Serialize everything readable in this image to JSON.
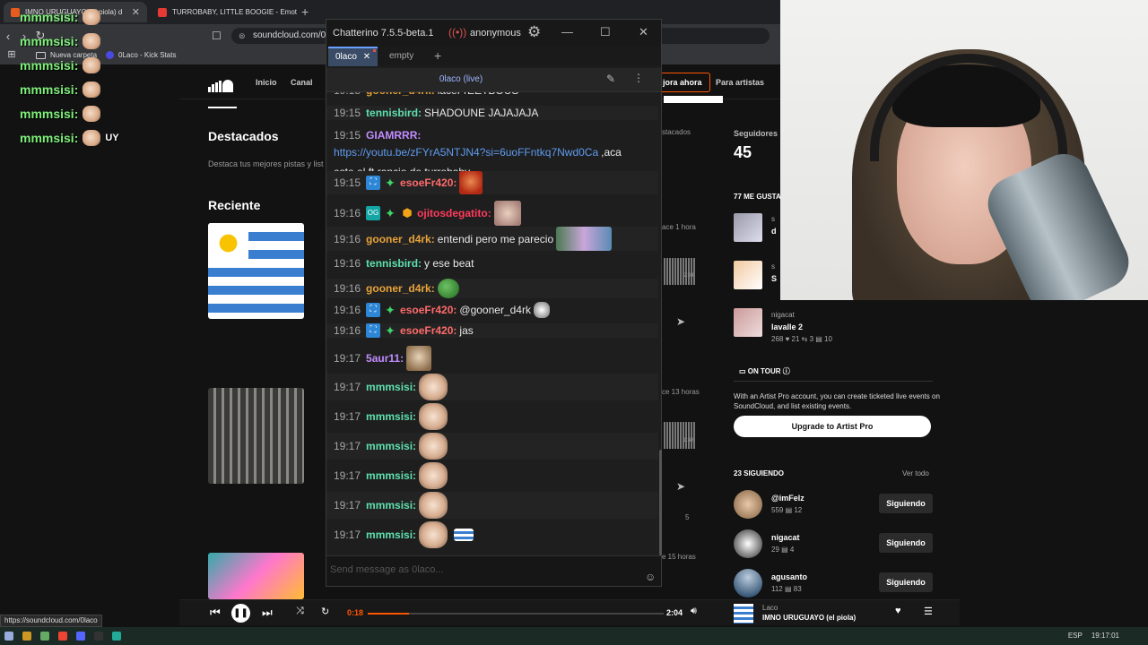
{
  "browser": {
    "tabs": [
      {
        "label": "IMNO URUGUAYO (el piola) d"
      },
      {
        "label": "TURROBABY, LITTLE BOOGIE - Emot"
      }
    ],
    "url": "soundcloud.com/0la",
    "bookmarks": [
      {
        "label": "Nueva carpeta"
      },
      {
        "label": "0Laco - Kick Stats"
      }
    ],
    "status_url": "https://soundcloud.com/0laco"
  },
  "overlay_chat": [
    {
      "user": "mmmsisi:",
      "text": ""
    },
    {
      "user": "mmmsisi:",
      "text": ""
    },
    {
      "user": "mmmsisi:",
      "text": ""
    },
    {
      "user": "mmmsisi:",
      "text": ""
    },
    {
      "user": "mmmsisi:",
      "text": ""
    },
    {
      "user": "mmmsisi:",
      "text": "UY"
    }
  ],
  "soundcloud": {
    "nav": {
      "home": "Inicio",
      "feed": "Canal",
      "premium": "jora ahora",
      "artists": "Para artistas"
    },
    "featured_title": "Destacados",
    "featured_sub": "Destaca tus mejores pistas y list",
    "recent_title": "Recient",
    "recent_title_full": "Reciente",
    "meta": {
      "tab_featured": "stacados",
      "ago1": "ace 1 hora",
      "time1": "2:04",
      "ago2": "ce 13 horas",
      "time2": "1:48",
      "plays": "5",
      "ago3": "e 15 horas"
    },
    "followers_label": "Seguidores",
    "followers_value": "45",
    "likes_label": "77 ME GUSTA",
    "liked_items": [
      {
        "name": "s",
        "title": "d"
      },
      {
        "name": "s",
        "title": "S"
      },
      {
        "name": "nigacat",
        "title": "lavalle 2",
        "stats": "268  ♥ 21  ⇆ 3  ▤ 10"
      }
    ],
    "tour_label": "ON TOUR",
    "tour_text": "With an Artist Pro account, you can create ticketed live events on SoundCloud, and list existing events.",
    "upgrade_label": "Upgrade to Artist Pro",
    "following_label": "23 SIGUIENDO",
    "view_all": "Ver todo",
    "following": [
      {
        "name": "@imFelz",
        "stats": "559  ▤ 12",
        "button": "Siguiendo"
      },
      {
        "name": "nigacat",
        "stats": "29  ▤ 4",
        "button": "Siguiendo"
      },
      {
        "name": "agusanto",
        "stats": "112  ▤ 83",
        "button": "Siguiendo"
      }
    ]
  },
  "player": {
    "elapsed": "0:18",
    "duration": "2:04",
    "progress": 0.14,
    "artist": "Laco",
    "title": "IMNO URUGUAYO (el piola)"
  },
  "taskbar": {
    "lang": "ESP",
    "time": "19:17:01"
  },
  "chatterino": {
    "title": "Chatterino 7.5.5-beta.1",
    "user": "anonymous",
    "tabs": [
      {
        "label": "0laco"
      },
      {
        "label": "empty"
      }
    ],
    "split_channel": "0laco (live)",
    "input_placeholder": "Send message as 0laco...",
    "messages": [
      {
        "time": "19:15",
        "user": "gooner_d4rk:",
        "color": "#e8a33a",
        "text": "laceFrEETBOUS",
        "badges": []
      },
      {
        "time": "19:15",
        "user": "tennisbird:",
        "color": "#5ee0b0",
        "text": "SHADOUNE JAJAJAJA",
        "badges": []
      },
      {
        "time": "19:15",
        "user": "GIAMRRR:",
        "color": "#c28cff",
        "link": "https://youtu.be/zFYrA5NTJN4?si=6uoFFntkq7Nwd0Ca",
        "text": " ,aca",
        "text2": "este el ft rancio de turrobaby",
        "badges": []
      },
      {
        "time": "19:15",
        "user": "esoeFr420:",
        "color": "#ff6b6b",
        "text": "",
        "emote": "face",
        "badges": [
          "sub",
          "star"
        ]
      },
      {
        "time": "19:16",
        "user": "ojitosdegatito:",
        "color": "#ff3b5c",
        "text": "",
        "emote": "cat",
        "badges": [
          "og",
          "star",
          "gift"
        ]
      },
      {
        "time": "19:16",
        "user": "gooner_d4rk:",
        "color": "#e8a33a",
        "text": "entendi pero me parecio",
        "emote": "wide",
        "badges": []
      },
      {
        "time": "19:16",
        "user": "tennisbird:",
        "color": "#5ee0b0",
        "text": "y ese beat",
        "badges": []
      },
      {
        "time": "19:16",
        "user": "gooner_d4rk:",
        "color": "#e8a33a",
        "text": "",
        "emote": "frog",
        "badges": []
      },
      {
        "time": "19:16",
        "user": "esoeFr420:",
        "color": "#ff6b6b",
        "text": "@gooner_d4rk",
        "emote": "wolf",
        "badges": [
          "sub",
          "star"
        ]
      },
      {
        "time": "19:16",
        "user": "esoeFr420:",
        "color": "#ff6b6b",
        "text": "jas",
        "badges": [
          "sub",
          "star"
        ]
      },
      {
        "time": "19:17",
        "user": "5aur11:",
        "color": "#c28cff",
        "text": "",
        "emote": "dog",
        "badges": []
      },
      {
        "time": "19:17",
        "user": "mmmsisi:",
        "color": "#5ee0b0",
        "text": "",
        "emote": "pig",
        "badges": []
      },
      {
        "time": "19:17",
        "user": "mmmsisi:",
        "color": "#5ee0b0",
        "text": "",
        "emote": "pig",
        "badges": []
      },
      {
        "time": "19:17",
        "user": "mmmsisi:",
        "color": "#5ee0b0",
        "text": "",
        "emote": "pig",
        "badges": []
      },
      {
        "time": "19:17",
        "user": "mmmsisi:",
        "color": "#5ee0b0",
        "text": "",
        "emote": "pig",
        "badges": []
      },
      {
        "time": "19:17",
        "user": "mmmsisi:",
        "color": "#5ee0b0",
        "text": "",
        "emote": "pig",
        "badges": []
      },
      {
        "time": "19:17",
        "user": "mmmsisi:",
        "color": "#5ee0b0",
        "text": "",
        "emote": "pig",
        "emote2": "flag",
        "badges": []
      }
    ]
  }
}
